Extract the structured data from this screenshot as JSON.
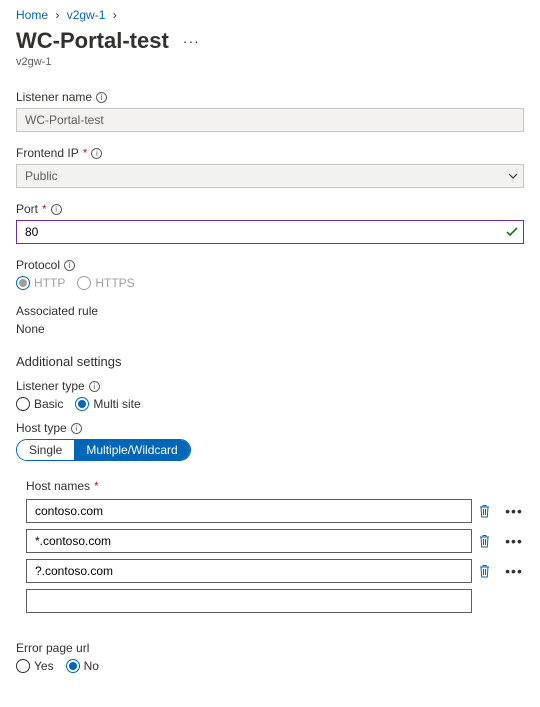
{
  "breadcrumb": {
    "home": "Home",
    "parent": "v2gw-1"
  },
  "page": {
    "title": "WC-Portal-test",
    "subtitle": "v2gw-1"
  },
  "listenerName": {
    "label": "Listener name",
    "value": "WC-Portal-test"
  },
  "frontendIp": {
    "label": "Frontend IP",
    "value": "Public"
  },
  "port": {
    "label": "Port",
    "value": "80"
  },
  "protocol": {
    "label": "Protocol",
    "options": {
      "http": "HTTP",
      "https": "HTTPS"
    }
  },
  "associatedRule": {
    "label": "Associated rule",
    "value": "None"
  },
  "additional": {
    "header": "Additional settings",
    "listenerType": {
      "label": "Listener type",
      "options": {
        "basic": "Basic",
        "multi": "Multi site"
      }
    },
    "hostType": {
      "label": "Host type",
      "options": {
        "single": "Single",
        "multi": "Multiple/Wildcard"
      }
    },
    "hostNames": {
      "label": "Host names",
      "items": [
        "contoso.com",
        "*.contoso.com",
        "?.contoso.com"
      ]
    }
  },
  "errorPage": {
    "label": "Error page url",
    "options": {
      "yes": "Yes",
      "no": "No"
    }
  }
}
